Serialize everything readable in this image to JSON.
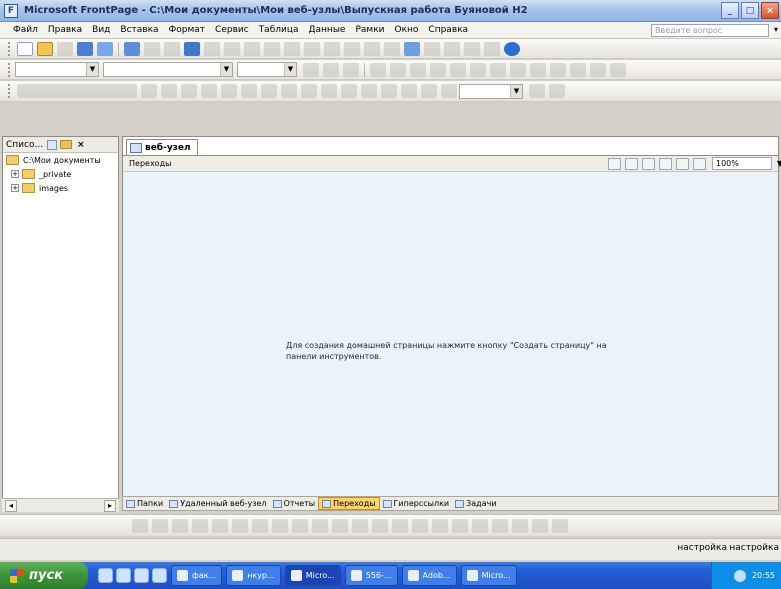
{
  "window": {
    "title": "Microsoft FrontPage - C:\\Мои документы\\Мои веб-узлы\\Выпускная работа Буяновой Н2",
    "app_icon": "frontpage-icon",
    "min_glyph": "_",
    "max_glyph": "□",
    "close_glyph": "×"
  },
  "menu": {
    "items": [
      "Файл",
      "Правка",
      "Вид",
      "Вставка",
      "Формат",
      "Сервис",
      "Таблица",
      "Данные",
      "Рамки",
      "Окно",
      "Справка"
    ],
    "help_placeholder": "Введите вопрос"
  },
  "folder_pane": {
    "title": "Списо...",
    "root": "C:\\Мои документы",
    "items": [
      "_private",
      "images"
    ]
  },
  "document": {
    "tab_label": "веб-узел",
    "view_name": "Переходы",
    "zoom": "100%",
    "hint": "Для создания домашней страницы нажмите кнопку \"Создать страницу\" на панели инструментов."
  },
  "view_switcher": {
    "items": [
      {
        "label": "Папки",
        "active": false
      },
      {
        "label": "Удаленный веб-узел",
        "active": false
      },
      {
        "label": "Отчеты",
        "active": false
      },
      {
        "label": "Переходы",
        "active": true
      },
      {
        "label": "Гиперссылки",
        "active": false
      },
      {
        "label": "Задачи",
        "active": false
      }
    ]
  },
  "status_bar": {
    "cell1": "настройка",
    "cell2": "настройка"
  },
  "taskbar": {
    "start_label": "пуск",
    "buttons": [
      {
        "label": "фак...",
        "active": false
      },
      {
        "label": "нкур...",
        "active": false
      },
      {
        "label": "Micro...",
        "active": true
      },
      {
        "label": "556-...",
        "active": false
      },
      {
        "label": "Adob...",
        "active": false
      },
      {
        "label": "Micro...",
        "active": false
      }
    ],
    "clock": "20:55"
  },
  "colors": {
    "title_bar": "#a9c3ea",
    "canvas_bg": "#eaf2fb",
    "active_view": "#fbd36f",
    "taskbar": "#245edb",
    "start_button": "#3b9437"
  }
}
